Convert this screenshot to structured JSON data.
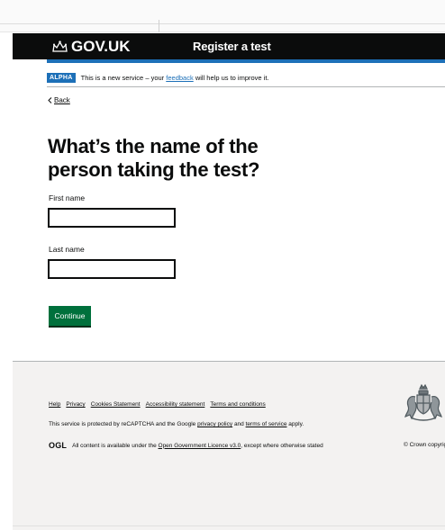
{
  "header": {
    "logo_text": "GOV.UK",
    "service_name": "Register a test"
  },
  "phase_banner": {
    "tag": "ALPHA",
    "message_before": "This is a new service – your",
    "feedback_link": "feedback",
    "message_after": "will help us to improve it."
  },
  "back_link": "Back",
  "heading": "What’s the name of the person taking the test?",
  "form": {
    "first_name_label": "First name",
    "first_name_value": "",
    "last_name_label": "Last name",
    "last_name_value": "",
    "continue_label": "Continue"
  },
  "footer": {
    "links": [
      "Help",
      "Privacy",
      "Cookies Statement",
      "Accessibility statement",
      "Terms and conditions"
    ],
    "recaptcha_before": "This service is protected by reCAPTCHA and the Google",
    "privacy_policy": "privacy policy",
    "recaptcha_and": "and",
    "terms_of_service": "terms of service",
    "recaptcha_after": "apply.",
    "ogl_logo": "OGL",
    "licence_before": "All content is available under the",
    "licence_link": "Open Government Licence v3.0",
    "licence_after": ", except where otherwise stated",
    "copyright": "© Crown copyright"
  },
  "icons": {
    "logo": "crown-icon",
    "crest": "royal-coat-of-arms-icon",
    "back": "chevron-left-icon"
  },
  "colors": {
    "header_bg": "#0b0c0c",
    "brand_blue": "#1d70b8",
    "button_green": "#00703c",
    "footer_bg": "#f3f2f1"
  }
}
